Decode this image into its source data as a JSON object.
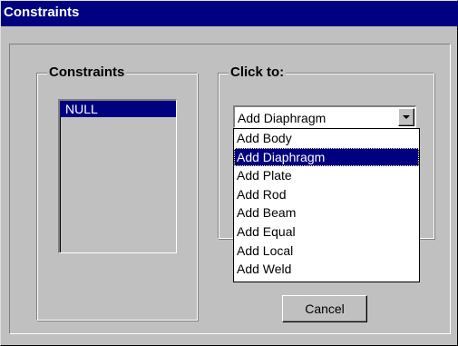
{
  "window": {
    "title": "Constraints"
  },
  "constraints_group": {
    "title": "Constraints",
    "items": [
      {
        "label": "NULL",
        "selected": true
      }
    ]
  },
  "action_group": {
    "title": "Click to:",
    "combo": {
      "selected": "Add Diaphragm",
      "options": [
        "Add Body",
        "Add Diaphragm",
        "Add Plate",
        "Add Rod",
        "Add Beam",
        "Add Equal",
        "Add Local",
        "Add Weld"
      ],
      "highlighted_index": 1
    }
  },
  "buttons": {
    "cancel": "Cancel"
  },
  "colors": {
    "titlebar": "#000080",
    "face": "#c0c0c0",
    "selection": "#000080"
  }
}
